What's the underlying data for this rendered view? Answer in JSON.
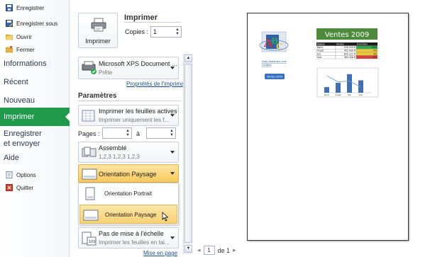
{
  "nav": {
    "commands_top": [
      {
        "label": "Enregistrer",
        "icon": "save-icon"
      },
      {
        "label": "Enregistrer sous",
        "icon": "save-as-icon"
      },
      {
        "label": "Ouvrir",
        "icon": "open-folder-icon"
      },
      {
        "label": "Fermer",
        "icon": "close-folder-icon"
      }
    ],
    "tabs": {
      "informations": "Informations",
      "recent": "Récent",
      "nouveau": "Nouveau",
      "imprimer": "Imprimer",
      "enregistrer_line1": "Enregistrer",
      "enregistrer_line2": "et envoyer",
      "aide": "Aide"
    },
    "commands_bottom": [
      {
        "label": "Options",
        "icon": "options-icon"
      },
      {
        "label": "Quitter",
        "icon": "exit-icon"
      }
    ]
  },
  "print": {
    "title": "Imprimer",
    "print_button": "Imprimer",
    "copies_label": "Copies :",
    "copies_value": "1"
  },
  "printer": {
    "name": "Microsoft XPS Document ...",
    "status": "Prête",
    "properties_link": "Propriétés de l'imprimante"
  },
  "settings": {
    "section_title": "Paramètres",
    "what_to_print": {
      "line1": "Imprimer les feuilles actives",
      "line2": "Imprimer uniquement les f..."
    },
    "pages_label": "Pages :",
    "pages_to_label": "à",
    "pages_from": "",
    "pages_to": "",
    "collate": {
      "line1": "Assemblé",
      "line2": "1,2,3   1,2,3   1,2,3"
    },
    "orientation": {
      "selected": "Orientation Paysage"
    },
    "orientation_menu": [
      {
        "label": "Orientation Portrait"
      },
      {
        "label": "Orientation Paysage"
      }
    ],
    "scaling": {
      "line1": "Pas de mise à l'échelle",
      "line2": "Imprimer les feuilles en tai..."
    },
    "page_setup_link": "Mise en page"
  },
  "preview": {
    "sheet_title": "Ventes 2009",
    "table_headers": [
      "Région",
      "Ventes",
      "Evolution"
    ],
    "table_rows": [
      [
        "Nord",
        "256 000 €",
        "10%"
      ],
      [
        "Ouest",
        "452 000 €",
        "2%"
      ],
      [
        "Est",
        "845 121 €",
        "3%"
      ],
      [
        "Sud",
        "565 458 €",
        "-5%"
      ]
    ],
    "link_text": "http://www.abc.com",
    "contact_text": "Contact",
    "button_text": "Ventes 2009",
    "chart_categories": [
      "Nord",
      "Ouest",
      "Est",
      "Sud"
    ],
    "evolution_colors": [
      "#2fa84f",
      "#e9c83a",
      "#e9c83a",
      "#d9403a"
    ],
    "current_page": "1",
    "page_of": "de 1"
  },
  "colors": {
    "accent_green": "#1e9a4a",
    "sheet_header": "#4e8a3c",
    "selection": "#f8c95c"
  }
}
